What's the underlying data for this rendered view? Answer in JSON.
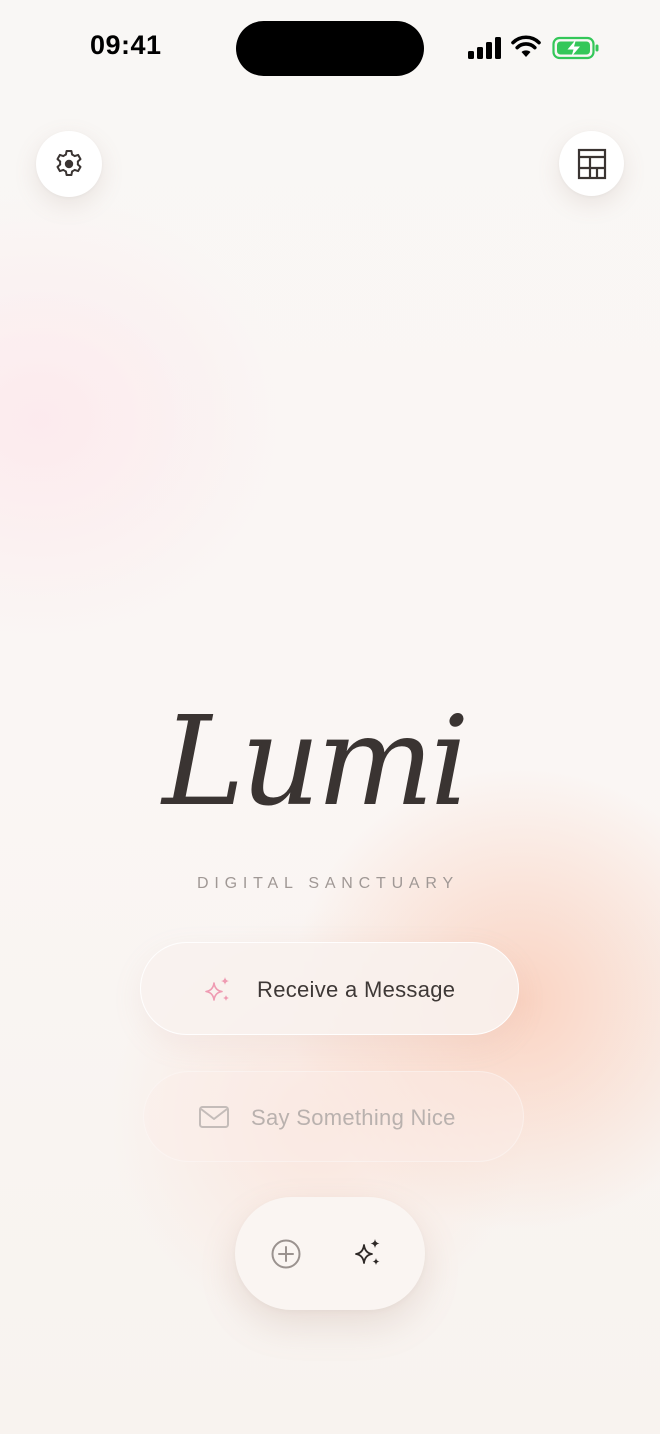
{
  "status_bar": {
    "time": "09:41",
    "icons": [
      "cellular-signal-icon",
      "wifi-icon",
      "battery-charging-icon"
    ],
    "battery_color": "#34c759"
  },
  "header": {
    "settings_icon": "gear-icon",
    "gallery_icon": "layout-grid-icon"
  },
  "hero": {
    "title": "Lumi",
    "subtitle": "DIGITAL SANCTUARY"
  },
  "actions": {
    "receive_label": "Receive a Message",
    "receive_icon": "sparkles-icon",
    "say_label": "Say Something Nice",
    "say_icon": "envelope-icon"
  },
  "bottom_bar": {
    "add_icon": "plus-circle-icon",
    "magic_icon": "sparkles-icon"
  },
  "colors": {
    "accent_pink": "#ef9bb2",
    "text_dark": "#3a3432",
    "text_muted": "#a09895",
    "background_warm": "#f9c8b2"
  }
}
